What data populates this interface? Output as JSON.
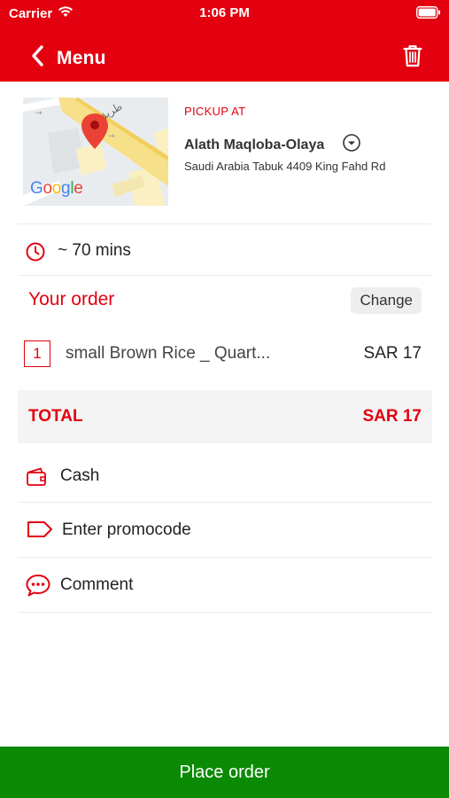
{
  "status_bar": {
    "carrier": "Carrier",
    "time": "1:06 PM",
    "icons": [
      "wifi-icon",
      "battery-icon"
    ]
  },
  "nav": {
    "back_label": "Menu",
    "back_icon": "chevron-left-icon",
    "delete_icon": "trash-icon"
  },
  "pickup": {
    "label": "PICKUP AT",
    "name": "Alath Maqloba-Olaya",
    "address": "Saudi Arabia Tabuk 4409 King Fahd Rd",
    "map_attribution": "Google",
    "map_street_label": "طريق",
    "dropdown_icon": "chevron-down-circle-icon"
  },
  "eta": {
    "icon": "clock-icon",
    "text": "~ 70 mins"
  },
  "order": {
    "title": "Your order",
    "change_label": "Change",
    "items": [
      {
        "qty": "1",
        "name": "small  Brown Rice _ Quart...",
        "price": "SAR 17"
      }
    ]
  },
  "total": {
    "label": "TOTAL",
    "value": "SAR 17"
  },
  "options": [
    {
      "icon": "wallet-icon",
      "label": "Cash"
    },
    {
      "icon": "tag-icon",
      "label": "Enter promocode"
    },
    {
      "icon": "comment-icon",
      "label": "Comment"
    }
  ],
  "place_order_label": "Place order",
  "colors": {
    "brand_red": "#e3000f",
    "place_order_green": "#0b8a06",
    "total_bg": "#f4f4f4",
    "divider": "#ececec"
  }
}
